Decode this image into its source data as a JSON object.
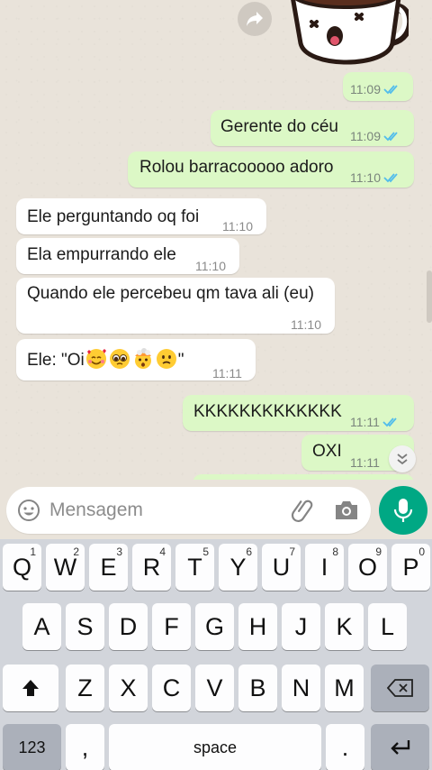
{
  "chat": {
    "sticker_time": "11:09",
    "messages": [
      {
        "dir": "out",
        "text": "Gerente do céu",
        "time": "11:09",
        "status": "read"
      },
      {
        "dir": "out",
        "text": "Rolou barracooooo adoro",
        "time": "11:10",
        "status": "read"
      },
      {
        "dir": "in",
        "text": "Ele perguntando oq foi",
        "time": "11:10"
      },
      {
        "dir": "in",
        "text": "Ela empurrando ele",
        "time": "11:10"
      },
      {
        "dir": "in",
        "text": "Quando ele percebeu qm tava ali (eu)",
        "time": "11:10"
      },
      {
        "dir": "in",
        "text_prefix": "Ele: \"Oi",
        "text_suffix": "\"",
        "emojis": [
          "smiling-face-with-hearts",
          "pleading-face",
          "exploding-head",
          "slightly-frowning-face"
        ],
        "time": "11:11"
      },
      {
        "dir": "out",
        "text": "KKKKKKKKKKKKK",
        "time": "11:11",
        "status": "read"
      },
      {
        "dir": "out",
        "text": "OXI",
        "time": "11:11",
        "status": "read"
      }
    ],
    "colors": {
      "outgoing": "#dcf8c6",
      "incoming": "#ffffff",
      "read_tick": "#53bdeb",
      "accent": "#00a884"
    }
  },
  "composer": {
    "placeholder": "Mensagem",
    "icons": [
      "emoji-icon",
      "attach-icon",
      "camera-icon",
      "mic-icon"
    ]
  },
  "keyboard": {
    "row1": [
      {
        "k": "Q",
        "h": "1"
      },
      {
        "k": "W",
        "h": "2"
      },
      {
        "k": "E",
        "h": "3"
      },
      {
        "k": "R",
        "h": "4"
      },
      {
        "k": "T",
        "h": "5"
      },
      {
        "k": "Y",
        "h": "6"
      },
      {
        "k": "U",
        "h": "7"
      },
      {
        "k": "I",
        "h": "8"
      },
      {
        "k": "O",
        "h": "9"
      },
      {
        "k": "P",
        "h": "0"
      }
    ],
    "row2": [
      "A",
      "S",
      "D",
      "F",
      "G",
      "H",
      "J",
      "K",
      "L"
    ],
    "row3": [
      "Z",
      "X",
      "C",
      "V",
      "B",
      "N",
      "M"
    ],
    "numbers_key": "123",
    "comma_key": ",",
    "space_key": "space",
    "period_key": "."
  }
}
